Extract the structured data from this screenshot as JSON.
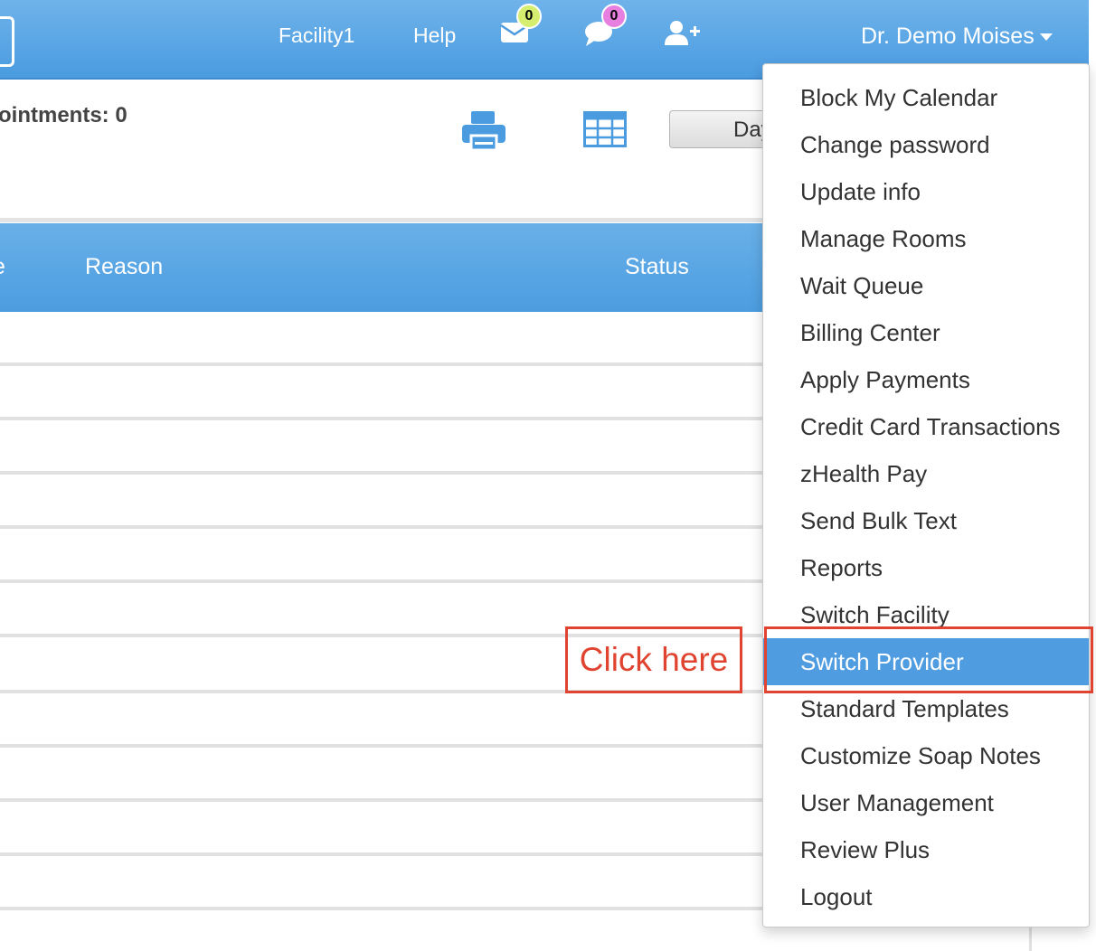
{
  "navbar": {
    "facility_label": "Facility1",
    "help_label": "Help",
    "messages_badge": "0",
    "chat_badge": "0",
    "user_name": "Dr. Demo Moises",
    "icons": [
      "envelope-icon",
      "chat-bubble-icon",
      "add-user-icon"
    ],
    "badge_colors": {
      "messages": "#d6ee70",
      "chat": "#e77fe0"
    }
  },
  "toolbar": {
    "appointments_label": "ointments: 0",
    "day_button_label": "Day"
  },
  "table": {
    "columns": [
      "e",
      "Reason",
      "Status"
    ]
  },
  "dropdown": {
    "items": [
      "Block My Calendar",
      "Change password",
      "Update info",
      "Manage Rooms",
      "Wait Queue",
      "Billing Center",
      "Apply Payments",
      "Credit Card Transactions",
      "zHealth Pay",
      "Send Bulk Text",
      "Reports",
      "Switch Facility",
      "Switch Provider",
      "Standard Templates",
      "Customize Soap Notes",
      "User Management",
      "Review Plus",
      "Logout"
    ],
    "active_item": "Switch Provider"
  },
  "annotation": {
    "label": "Click here",
    "color": "#e0432f"
  },
  "colors": {
    "primary_blue": "#4f9de0",
    "header_gradient_top": "#6fb3ea"
  }
}
